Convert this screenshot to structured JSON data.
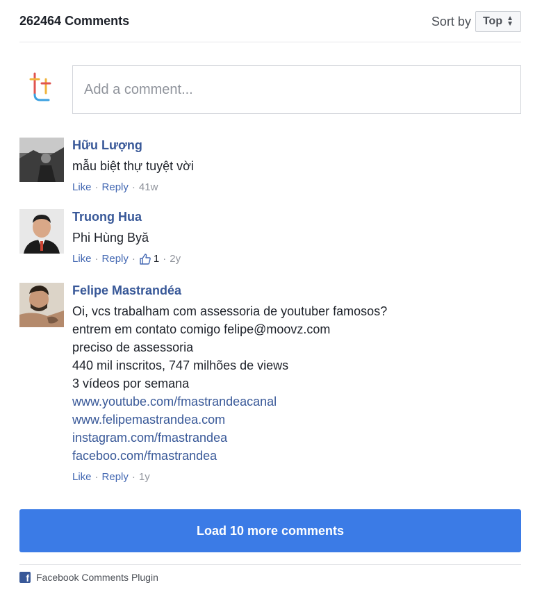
{
  "header": {
    "comment_count": "262464 Comments",
    "sort_label": "Sort by",
    "sort_value": "Top"
  },
  "compose": {
    "placeholder": "Add a comment..."
  },
  "comments": [
    {
      "author": "Hữu Lượng",
      "lines": [
        "mẫu biệt thự tuyệt vời"
      ],
      "like": "Like",
      "reply": "Reply",
      "time": "41w"
    },
    {
      "author": "Truong Hua",
      "lines": [
        "Phi Hùng Byă"
      ],
      "like": "Like",
      "reply": "Reply",
      "likes": "1",
      "time": "2y"
    },
    {
      "author": "Felipe Mastrandéa",
      "lines": [
        "Oi, vcs trabalham com assessoria de youtuber famosos?",
        "entrem em contato comigo felipe@moovz.com",
        "preciso de assessoria",
        "440 mil inscritos, 747 milhões de views",
        "3 vídeos por semana"
      ],
      "links": [
        "www.youtube.com/fmastrandeacanal",
        "www.felipemastrandea.com",
        "instagram.com/fmastrandea",
        "faceboo.com/fmastrandea"
      ],
      "like": "Like",
      "reply": "Reply",
      "time": "1y"
    }
  ],
  "load_more": "Load 10 more comments",
  "footer": {
    "plugin_label": "Facebook Comments Plugin"
  },
  "colors": {
    "link": "#385898",
    "button": "#3b7be6"
  }
}
